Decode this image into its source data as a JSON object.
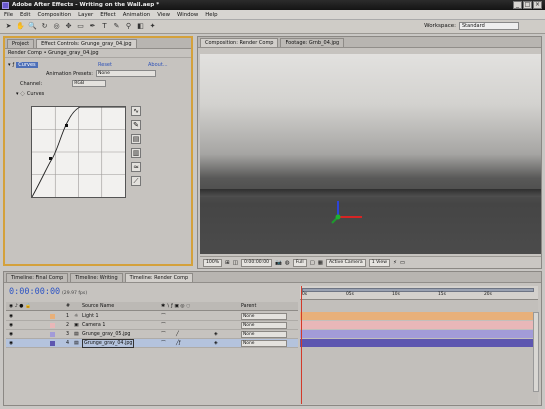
{
  "window": {
    "title": "Adobe After Effects - Writing on the Wall.aep *"
  },
  "menu": [
    "File",
    "Edit",
    "Composition",
    "Layer",
    "Effect",
    "Animation",
    "View",
    "Window",
    "Help"
  ],
  "workspace": {
    "label": "Workspace:",
    "value": "Standard"
  },
  "left_panel": {
    "tabs": [
      "Project",
      "Effect Controls: Grunge_gray_04.jpg"
    ],
    "subtitle": "Render Comp • Grunge_gray_04.jpg",
    "effect_name": "Curves",
    "reset": "Reset",
    "about": "About...",
    "presets_label": "Animation Presets:",
    "presets_value": "None",
    "channel_label": "Channel:",
    "channel_value": "RGB",
    "curves_label": "Curves"
  },
  "comp_panel": {
    "tabs": [
      "Composition: Render Comp",
      "Footage: Grnb_04.jpg"
    ],
    "viewer_bar": [
      "100%",
      "0:00:00:00",
      "Full",
      "Active Camera",
      "1 View"
    ]
  },
  "timeline": {
    "tabs": [
      "Timeline: Final Comp",
      "Timeline: Writing",
      "Timeline: Render Comp"
    ],
    "timecode": "0:00:00:00",
    "fps": "(29.97 fps)",
    "header": {
      "num": "#",
      "source": "Source Name",
      "parent": "Parent"
    },
    "layers": [
      {
        "num": "1",
        "name": "Light 1",
        "parent": "None",
        "color": "#e8b07a"
      },
      {
        "num": "2",
        "name": "Camera 1",
        "parent": "None",
        "color": "#e9b7b8"
      },
      {
        "num": "3",
        "name": "Grunge_gray_05.jpg",
        "parent": "None",
        "color": "#a29bd8"
      },
      {
        "num": "4",
        "name": "Grunge_gray_04.jpg",
        "parent": "None",
        "color": "#5d56b0"
      }
    ],
    "ruler": [
      "0s",
      "05s",
      "10s",
      "15s",
      "20s"
    ]
  }
}
